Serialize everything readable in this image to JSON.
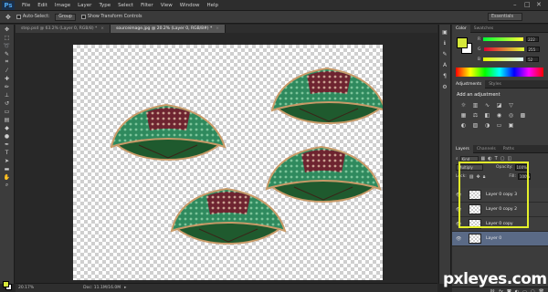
{
  "app": {
    "logo": "Ps"
  },
  "menu": [
    "File",
    "Edit",
    "Image",
    "Layer",
    "Type",
    "Select",
    "Filter",
    "View",
    "Window",
    "Help"
  ],
  "options": {
    "auto_select_label": "Auto-Select:",
    "auto_select_value": "Group",
    "transform_label": "Show Transform Controls",
    "workspace": "Essentials"
  },
  "tabs": [
    {
      "label": "step.psd @ 63.2% (Layer 0, RGB/8) *",
      "active": false
    },
    {
      "label": "sourceimage.jpg @ 20.2% (Layer 0, RGB/8#) *",
      "active": true
    }
  ],
  "status": {
    "zoom": "20.17%",
    "doc": "Doc: 11.1M/16.0M"
  },
  "color_panel": {
    "tabs": [
      "Color",
      "Swatches"
    ],
    "channels": [
      {
        "label": "R",
        "value": "222"
      },
      {
        "label": "G",
        "value": "255"
      },
      {
        "label": "B",
        "value": "52"
      }
    ],
    "foreground": "#d6e83a"
  },
  "adjustments": {
    "tabs": [
      "Adjustments",
      "Styles"
    ],
    "title": "Add an adjustment"
  },
  "layers_panel": {
    "tabs": [
      "Layers",
      "Channels",
      "Paths"
    ],
    "kind": "Kind",
    "blend_mode": "Multiply",
    "opacity_label": "Opacity:",
    "opacity": "100%",
    "lock_label": "Lock:",
    "fill_label": "Fill:",
    "fill": "100%",
    "layers": [
      {
        "name": "Layer 0 copy 3",
        "selected": false
      },
      {
        "name": "Layer 0 copy 2",
        "selected": false
      },
      {
        "name": "Layer 0 copy",
        "selected": false
      },
      {
        "name": "Layer 0",
        "selected": true
      }
    ]
  },
  "watermark": "pxleyes.com",
  "colors": {
    "highlight": "#e4f02a",
    "selection": "#5a6a86"
  }
}
